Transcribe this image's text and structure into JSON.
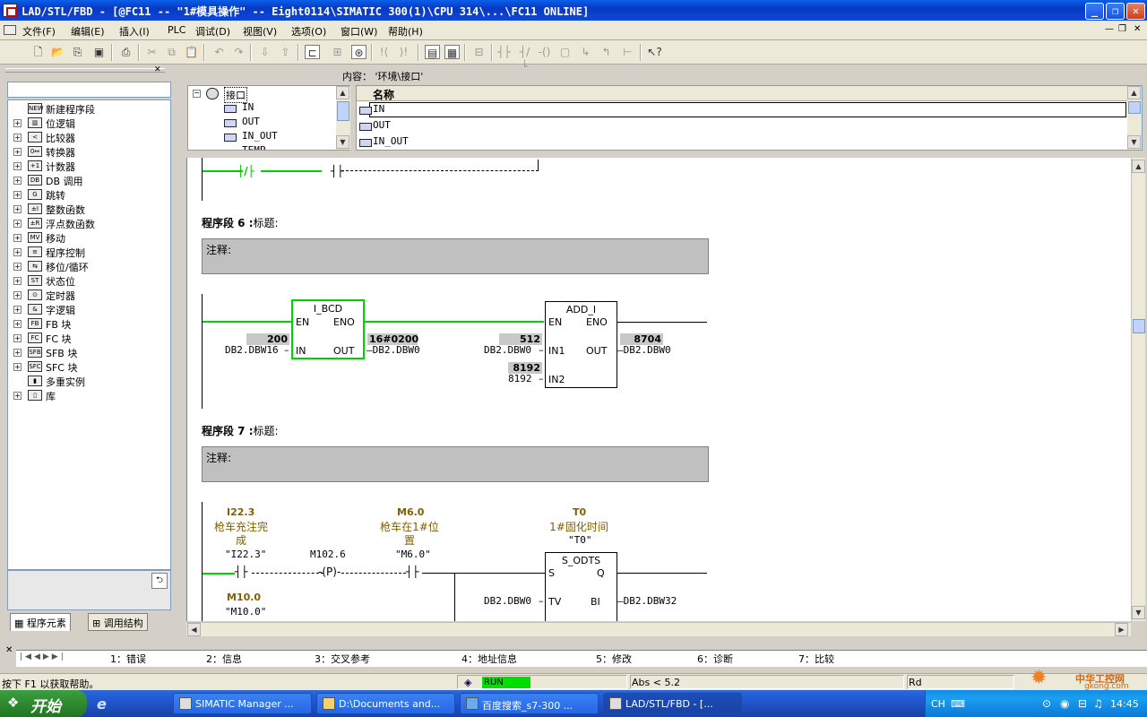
{
  "window": {
    "title": "LAD/STL/FBD  - [@FC11 -- \"1#模具操作\" -- Eight0114\\SIMATIC 300(1)\\CPU 314\\...\\FC11  ONLINE]"
  },
  "menu": [
    "文件(F)",
    "编辑(E)",
    "插入(I)",
    "PLC",
    "调试(D)",
    "视图(V)",
    "选项(O)",
    "窗口(W)",
    "帮助(H)"
  ],
  "left_tree": {
    "items": [
      {
        "label": "新建程序段",
        "icon": "new-network-icon",
        "expand": false
      },
      {
        "label": "位逻辑",
        "icon": "bit-logic-icon",
        "expand": true
      },
      {
        "label": "比较器",
        "icon": "comparator-icon",
        "expand": true
      },
      {
        "label": "转换器",
        "icon": "converter-icon",
        "expand": true
      },
      {
        "label": "计数器",
        "icon": "counter-icon",
        "expand": true
      },
      {
        "label": "DB 调用",
        "icon": "db-call-icon",
        "expand": true
      },
      {
        "label": "跳转",
        "icon": "jump-icon",
        "expand": true
      },
      {
        "label": "整数函数",
        "icon": "integer-function-icon",
        "expand": true
      },
      {
        "label": "浮点数函数",
        "icon": "float-function-icon",
        "expand": true
      },
      {
        "label": "移动",
        "icon": "move-icon",
        "expand": true
      },
      {
        "label": "程序控制",
        "icon": "program-control-icon",
        "expand": true
      },
      {
        "label": "移位/循环",
        "icon": "shift-rotate-icon",
        "expand": true
      },
      {
        "label": "状态位",
        "icon": "status-bit-icon",
        "expand": true
      },
      {
        "label": "定时器",
        "icon": "timer-icon",
        "expand": true
      },
      {
        "label": "字逻辑",
        "icon": "word-logic-icon",
        "expand": true
      },
      {
        "label": "FB 块",
        "icon": "fb-block-icon",
        "expand": true
      },
      {
        "label": "FC 块",
        "icon": "fc-block-icon",
        "expand": true
      },
      {
        "label": "SFB 块",
        "icon": "sfb-block-icon",
        "expand": true
      },
      {
        "label": "SFC 块",
        "icon": "sfc-block-icon",
        "expand": true
      },
      {
        "label": "多重实例",
        "icon": "multi-instance-icon",
        "expand": false
      },
      {
        "label": "库",
        "icon": "library-icon",
        "expand": true
      }
    ],
    "tab_elements": "程序元素",
    "tab_calls": "调用结构"
  },
  "interface": {
    "content_label": "内容：",
    "content_value": "'环境\\接口'",
    "root": "接口",
    "tree_items": [
      "IN",
      "OUT",
      "IN_OUT",
      "TEMP"
    ],
    "name_header": "名称",
    "rows": [
      "IN",
      "OUT",
      "IN_OUT"
    ]
  },
  "editor": {
    "seg6": {
      "title": "程序段 6",
      "sep": ":",
      "label": "标题:",
      "comment": "注释:",
      "ibcd": {
        "title": "I_BCD",
        "en": "EN",
        "eno": "ENO",
        "in": "IN",
        "out": "OUT",
        "in_val": "200",
        "in_addr": "DB2.DBW16",
        "out_val": "16#0200",
        "out_addr": "DB2.DBW0"
      },
      "add": {
        "title": "ADD_I",
        "en": "EN",
        "eno": "ENO",
        "in1": "IN1",
        "in2": "IN2",
        "out": "OUT",
        "in1_val": "512",
        "in1_addr": "DB2.DBW0",
        "in2_val": "8192",
        "in2_addr": "8192",
        "out_val": "8704",
        "out_addr": "DB2.DBW0"
      }
    },
    "seg7": {
      "title": "程序段 7",
      "sep": ":",
      "label": "标题:",
      "comment": "注释:",
      "c1": {
        "addr": "I22.3",
        "sym1": "枪车充注完",
        "sym2": "成",
        "q": "\"I22.3\""
      },
      "p": {
        "addr": "M102.6",
        "label": "P"
      },
      "c2": {
        "addr": "M6.0",
        "sym1": "枪车在1#位",
        "sym2": "置",
        "q": "\"M6.0\""
      },
      "timer": {
        "addr": "T0",
        "sym": "1#固化时间",
        "q": "\"T0\"",
        "title": "S_ODTS",
        "s": "S",
        "qpin": "Q",
        "tv": "TV",
        "bi": "BI",
        "tv_addr": "DB2.DBW0",
        "bi_addr": "DB2.DBW32"
      },
      "c3": {
        "addr": "M10.0",
        "q": "\"M10.0\""
      }
    }
  },
  "bottom_tabs": [
    "1：错误",
    "2：信息",
    "3：交叉参考",
    "4：地址信息",
    "5：修改",
    "6：诊断",
    "7：比较"
  ],
  "status": {
    "help": "按下 F1 以获取帮助。",
    "run": "RUN",
    "abs": "Abs < 5.2",
    "rd": "Rd"
  },
  "taskbar": {
    "start": "开始",
    "items": [
      "SIMATIC Manager ...",
      "D:\\Documents and...",
      "百度搜索_s7-300 ...",
      "LAD/STL/FBD  - [..."
    ],
    "lang": "CH",
    "clock": "14:45",
    "watermark1": "中华工控网",
    "watermark2": "gkong.com"
  },
  "colors": {
    "wire_active": "#00d000",
    "comment_bg": "#c0c0c0",
    "symbol_text": "#806000"
  }
}
